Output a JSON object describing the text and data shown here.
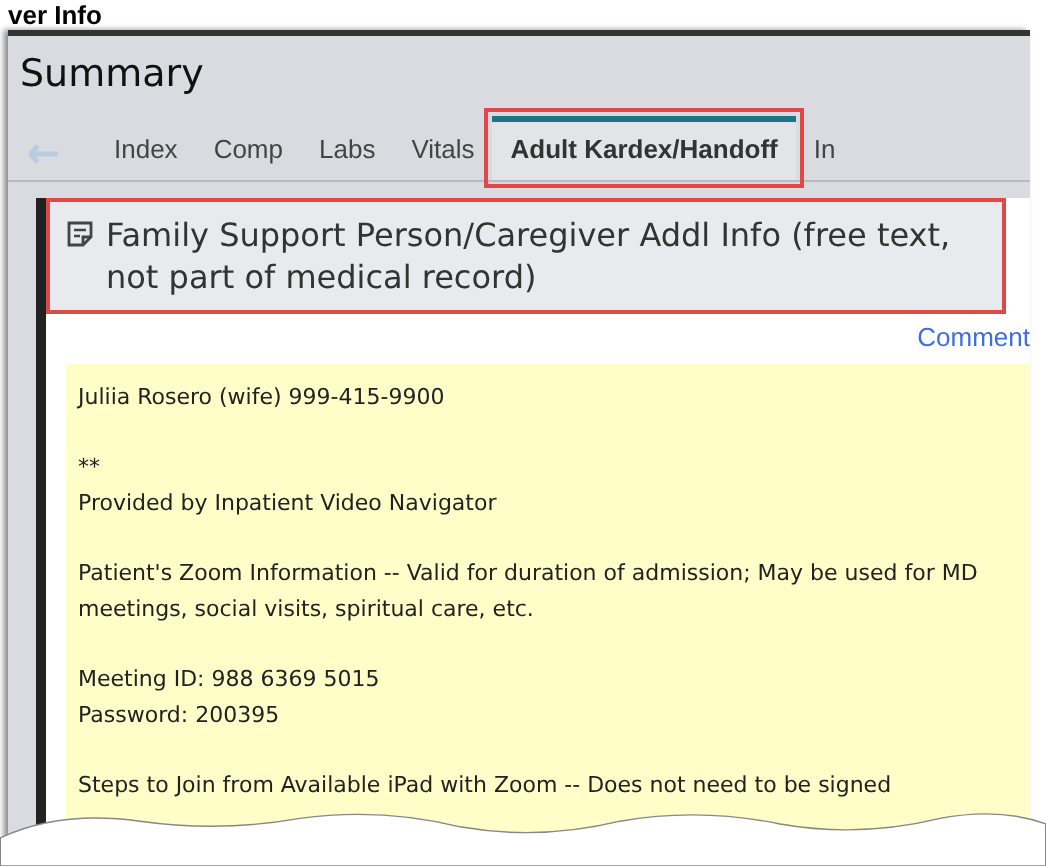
{
  "page_heading": "ver Info",
  "window": {
    "title": "Summary"
  },
  "tabs": [
    {
      "label": "Index",
      "selected": false
    },
    {
      "label": "Comp",
      "selected": false
    },
    {
      "label": "Labs",
      "selected": false
    },
    {
      "label": "Vitals",
      "selected": false
    },
    {
      "label": "Adult Kardex/Handoff",
      "selected": true
    },
    {
      "label": "In",
      "selected": false
    }
  ],
  "section": {
    "title": "Family Support Person/Caregiver Addl Info (free text, not part of medical record)",
    "comment_link": "Comment",
    "note_paragraphs": [
      [
        "Juliia Rosero (wife) 999-415-9900"
      ],
      [
        "**",
        "Provided by Inpatient Video Navigator"
      ],
      [
        "Patient's Zoom Information -- Valid for duration of admission; May be used for MD meetings, social visits, spiritual care, etc."
      ],
      [
        "Meeting ID: 988 6369 5015",
        "Password: 200395"
      ],
      [
        "Steps to Join from Available iPad with Zoom -- Does not need to be signed"
      ]
    ]
  }
}
